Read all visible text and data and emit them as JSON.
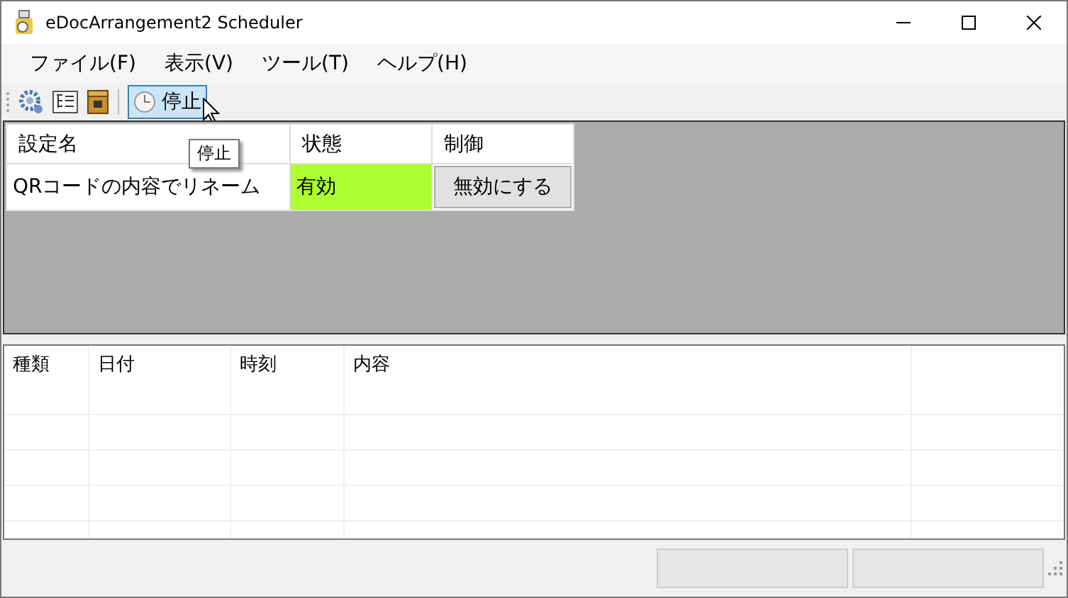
{
  "window": {
    "title": "eDocArrangement2 Scheduler"
  },
  "menu": [
    {
      "label": "ファイル(F)"
    },
    {
      "label": "表示(V)"
    },
    {
      "label": "ツール(T)"
    },
    {
      "label": "ヘルプ(H)"
    }
  ],
  "toolbar": {
    "stop_button": {
      "label": "停止",
      "pressed": true
    },
    "tooltip": "停止"
  },
  "settings_table": {
    "columns": [
      "設定名",
      "状態",
      "制御"
    ],
    "rows": [
      {
        "name": "QRコードの内容でリネーム",
        "status": "有効",
        "enabled": true,
        "action": "無効にする"
      }
    ]
  },
  "log_table": {
    "columns": [
      "種類",
      "日付",
      "時刻",
      "内容"
    ]
  }
}
